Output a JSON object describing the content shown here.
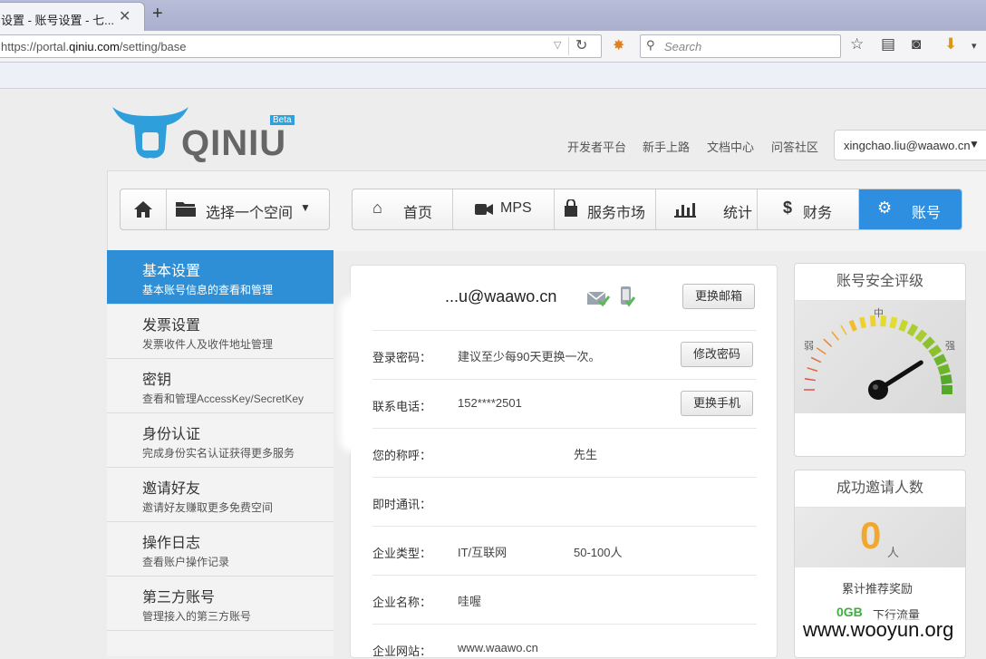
{
  "browser": {
    "tab_title": "设置 - 账号设置 - 七...",
    "tab_close": "✕",
    "new_tab": "+",
    "url_prefix": "https://portal.",
    "url_domain": "qiniu.com",
    "url_path": "/setting/base",
    "search_placeholder": "Search"
  },
  "header": {
    "logo_text": "QINIU",
    "beta": "Beta",
    "links": [
      "开发者平台",
      "新手上路",
      "文档中心",
      "问答社区"
    ],
    "user_email": "xingchao.liu@waawo.cn"
  },
  "space_selector": {
    "label": "选择一个空间"
  },
  "nav": [
    {
      "icon": "home-icon",
      "label": "首页"
    },
    {
      "icon": "video-camera-icon",
      "label": "MPS"
    },
    {
      "icon": "shopping-bag-icon",
      "label": "服务市场"
    },
    {
      "icon": "bar-chart-icon",
      "label": "统计"
    },
    {
      "icon": "dollar-icon",
      "label": "财务"
    },
    {
      "icon": "gears-icon",
      "label": "账号",
      "active": true
    }
  ],
  "sidebar": [
    {
      "title": "基本设置",
      "sub": "基本账号信息的查看和管理",
      "active": true
    },
    {
      "title": "发票设置",
      "sub": "发票收件人及收件地址管理"
    },
    {
      "title": "密钥",
      "sub": "查看和管理AccessKey/SecretKey"
    },
    {
      "title": "身份认证",
      "sub": "完成身份实名认证获得更多服务"
    },
    {
      "title": "邀请好友",
      "sub": "邀请好友赚取更多免费空间"
    },
    {
      "title": "操作日志",
      "sub": "查看账户操作记录"
    },
    {
      "title": "第三方账号",
      "sub": "管理接入的第三方账号"
    }
  ],
  "account": {
    "email_visible": "...u@waawo.cn",
    "change_email_button": "更换邮箱",
    "password_label": "登录密码：",
    "password_hint": "建议至少每90天更换一次。",
    "change_password_button": "修改密码",
    "phone_label": "联系电话：",
    "phone_value": "152****2501",
    "change_phone_button": "更换手机",
    "nickname_label": "您的称呼：",
    "nickname_title": "先生",
    "im_label": "即时通讯：",
    "company_type_label": "企业类型：",
    "company_type": "IT/互联网",
    "company_size": "50-100人",
    "company_name_label": "企业名称：",
    "company_name": "哇喔",
    "company_site_label": "企业网站：",
    "company_site": "www.waawo.cn"
  },
  "security_widget": {
    "title": "账号安全评级",
    "weak": "弱",
    "medium": "中",
    "strong": "强",
    "level": 0.82
  },
  "invite_widget": {
    "title": "成功邀请人数",
    "count": "0",
    "unit": "人",
    "reward_label": "累计推荐奖励",
    "reward_value": "0GB",
    "reward_suffix": "下行流量"
  },
  "watermark": "www.wooyun.org"
}
